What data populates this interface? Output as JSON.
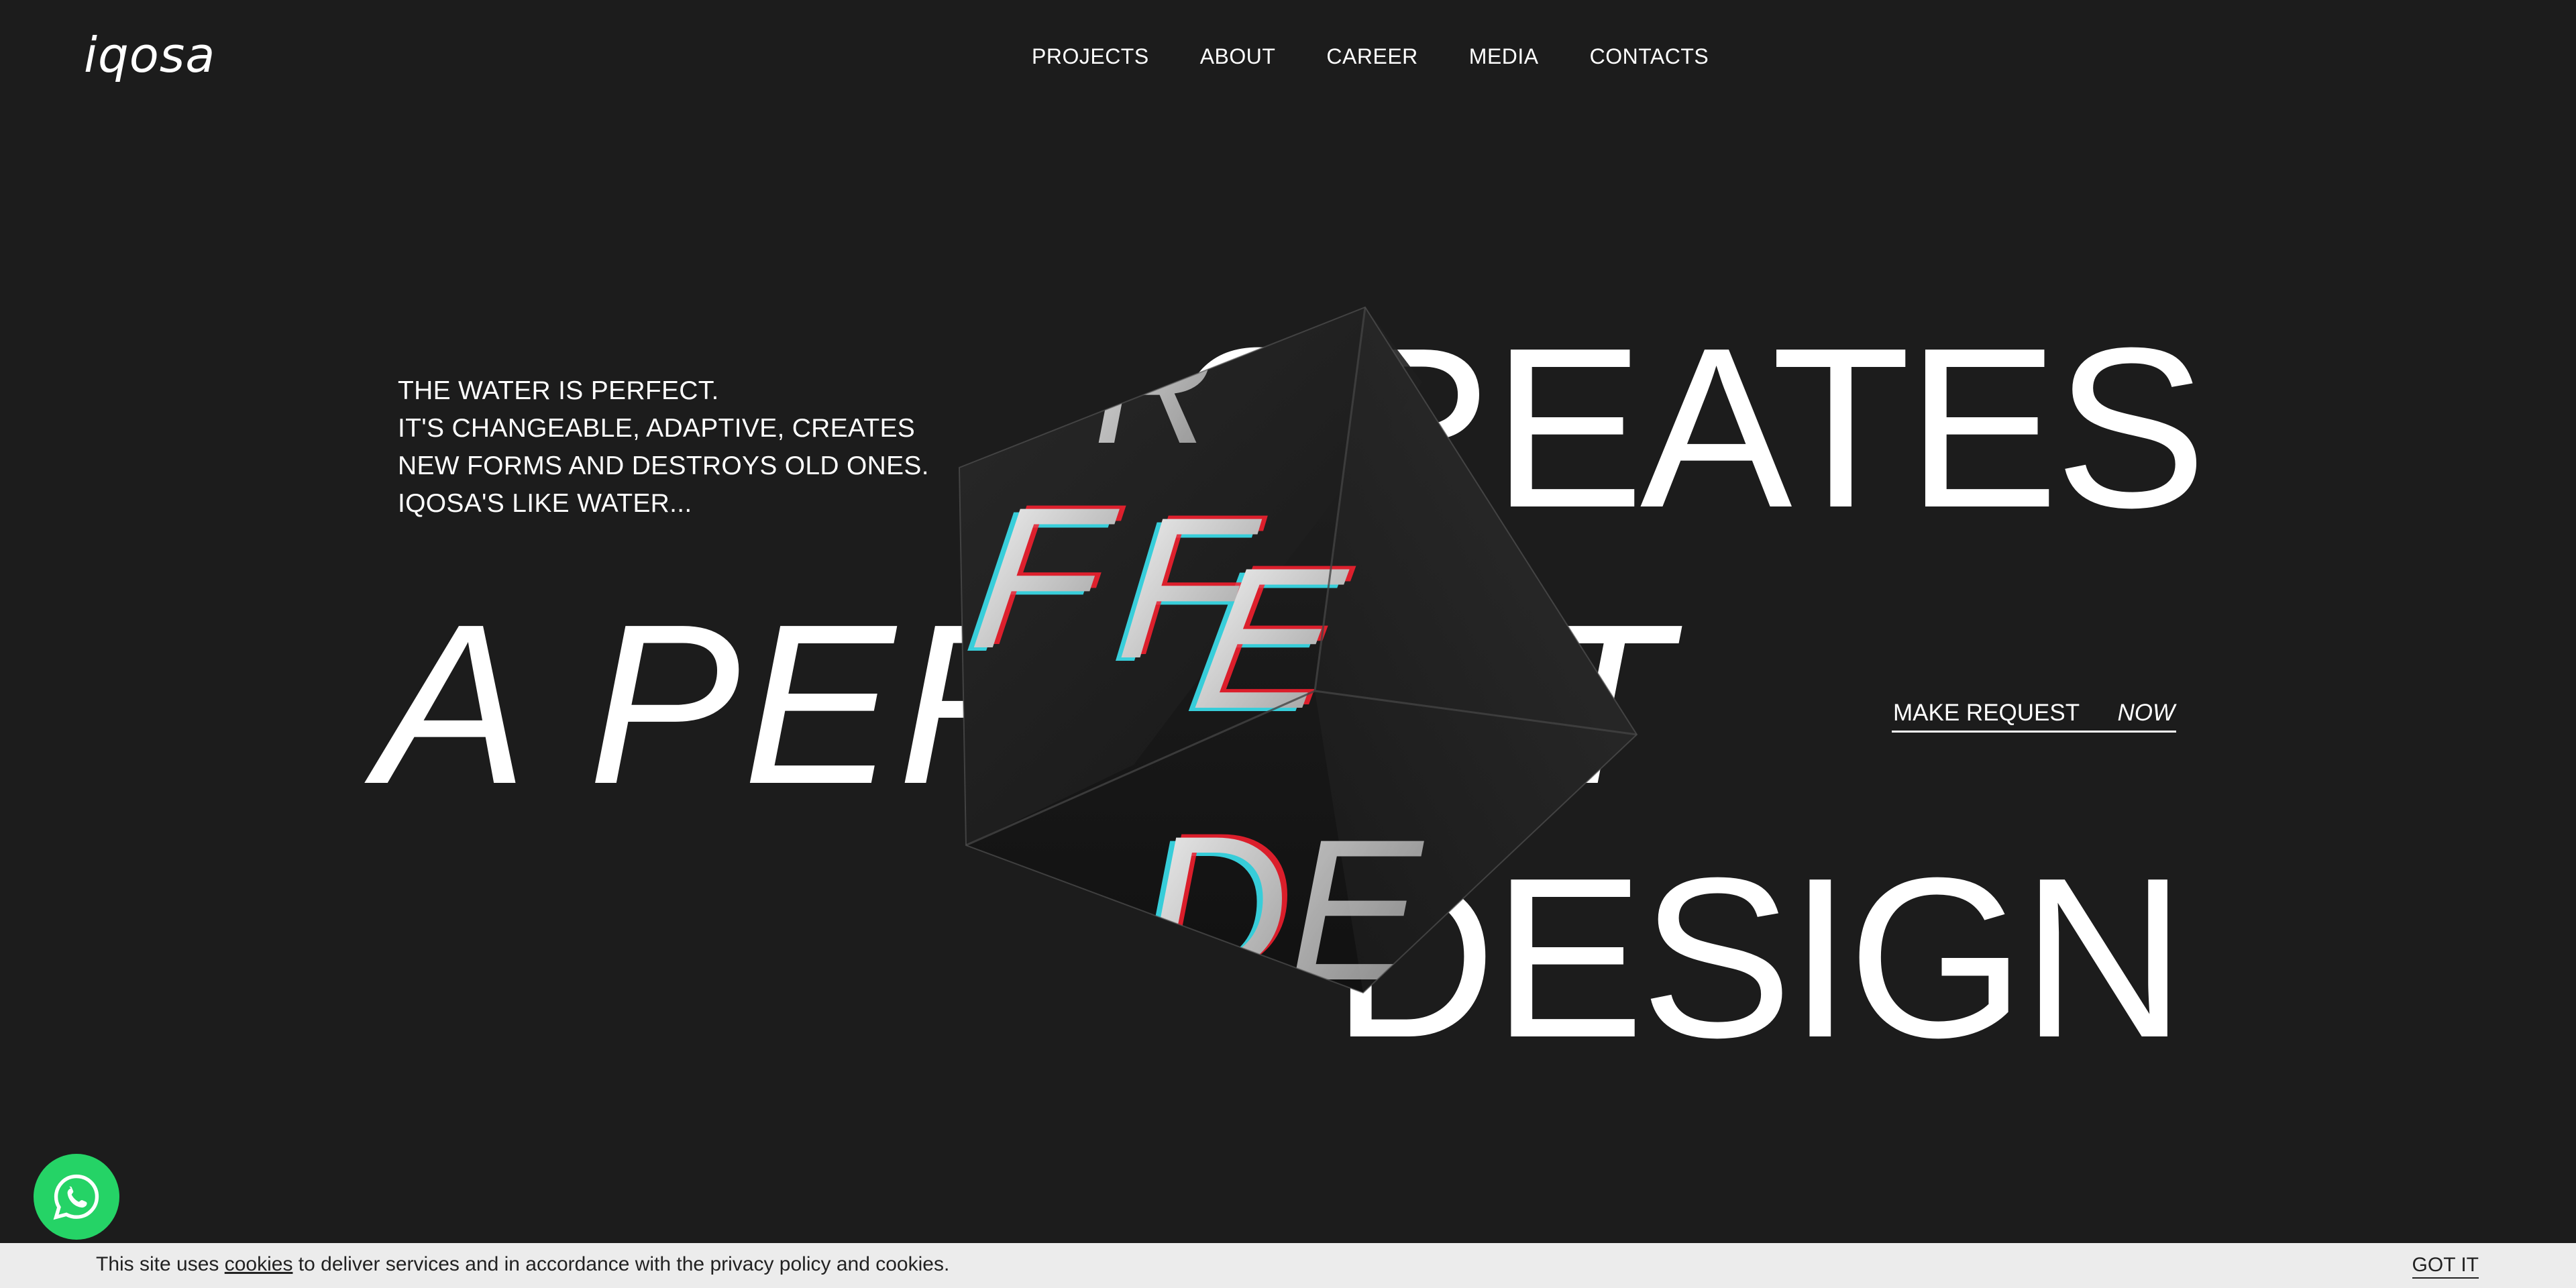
{
  "header": {
    "logo": "iqosa",
    "nav": [
      "PROJECTS",
      "ABOUT",
      "CAREER",
      "MEDIA",
      "CONTACTS"
    ]
  },
  "intro": {
    "lines": [
      "THE WATER IS PERFECT.",
      "IT'S CHANGEABLE, ADAPTIVE, CREATES",
      "NEW FORMS AND DESTROYS OLD ONES.",
      "IQOSA'S LIKE WATER..."
    ]
  },
  "headline": {
    "word1": "CREATES",
    "word2": "A PERFECT",
    "word3": "DESIGN"
  },
  "cta": {
    "label": "MAKE REQUEST",
    "suffix": "NOW"
  },
  "whatsapp": {
    "icon": "whatsapp-icon",
    "color": "#25d366"
  },
  "cookie_bar": {
    "prefix": "This site uses ",
    "link": "cookies",
    "suffix": " to deliver services and in accordance with the privacy policy and cookies.",
    "button": "GOT IT"
  },
  "colors": {
    "background": "#1c1c1c",
    "text": "#ffffff",
    "cookie_bg": "#ececec",
    "aberration_cyan": "#3be3f0",
    "aberration_red": "#ff2030"
  }
}
